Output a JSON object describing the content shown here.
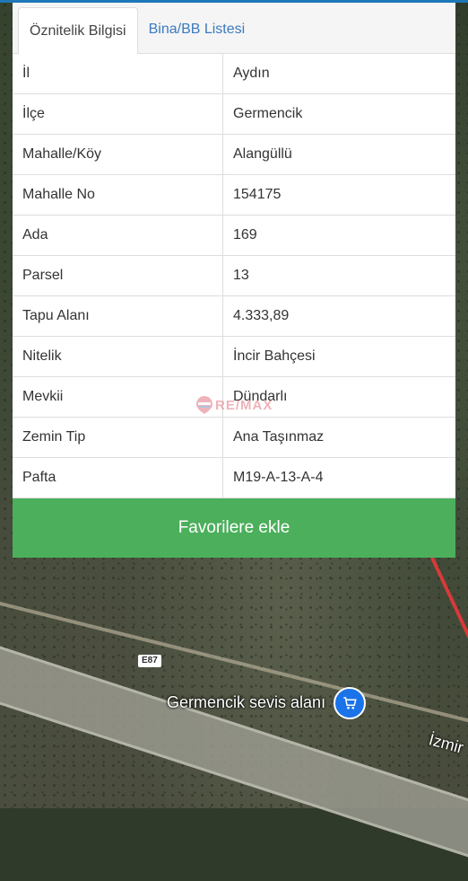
{
  "tabs": [
    {
      "label": "Öznitelik Bilgisi",
      "active": true
    },
    {
      "label": "Bina/BB Listesi",
      "active": false
    }
  ],
  "rows": [
    {
      "key": "İl",
      "value": "Aydın"
    },
    {
      "key": "İlçe",
      "value": "Germencik"
    },
    {
      "key": "Mahalle/Köy",
      "value": "Alangüllü"
    },
    {
      "key": "Mahalle No",
      "value": "154175"
    },
    {
      "key": "Ada",
      "value": "169"
    },
    {
      "key": "Parsel",
      "value": "13"
    },
    {
      "key": "Tapu Alanı",
      "value": "4.333,89"
    },
    {
      "key": "Nitelik",
      "value": "İncir Bahçesi"
    },
    {
      "key": "Mevkii",
      "value": "Dündarlı"
    },
    {
      "key": "Zemin Tip",
      "value": "Ana Taşınmaz"
    },
    {
      "key": "Pafta",
      "value": "M19-A-13-A-4"
    }
  ],
  "favorite_button": "Favorilere ekle",
  "watermark": "RE/MAX",
  "map": {
    "road_shield": "E87",
    "poi_label": "Germencik sevis alanı",
    "place_label": "İzmir",
    "poi_icon": "shopping-cart-icon"
  },
  "colors": {
    "accent_blue": "#1e77b6",
    "button_green": "#4caf5c",
    "tab_link": "#3a7bbf"
  }
}
